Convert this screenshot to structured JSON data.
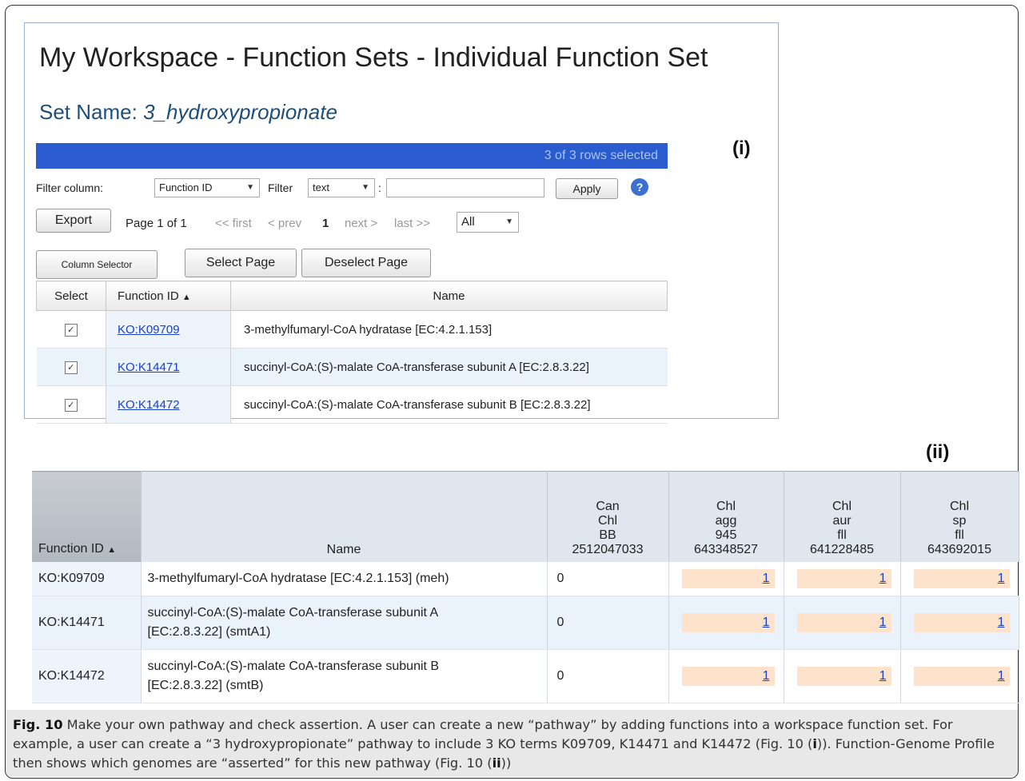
{
  "panel1": {
    "title": "My Workspace - Function Sets - Individual Function Set",
    "set_name_label": "Set Name:",
    "set_name_value": "3_hydroxypropionate",
    "label": "(i)",
    "rows_selected": "3 of 3 rows selected",
    "filter": {
      "column_label": "Filter column:",
      "column_value": "Function ID",
      "filter_label": "Filter",
      "filter_value": "text",
      "colon": ":",
      "input_value": "",
      "apply_label": "Apply",
      "help_icon": "?"
    },
    "paging": {
      "export_label": "Export",
      "page_info": "Page 1 of 1",
      "first": "<< first",
      "prev": "< prev",
      "current": "1",
      "next": "next >",
      "last": "last >>",
      "per_page": "All"
    },
    "buttons": {
      "column_selector": "Column Selector",
      "select_page": "Select Page",
      "deselect_page": "Deselect Page"
    },
    "table": {
      "headers": {
        "select": "Select",
        "function_id": "Function ID",
        "name": "Name"
      },
      "rows": [
        {
          "checked": "✓",
          "id": "KO:K09709",
          "name": "3-methylfumaryl-CoA hydratase [EC:4.2.1.153]"
        },
        {
          "checked": "✓",
          "id": "KO:K14471",
          "name": "succinyl-CoA:(S)-malate CoA-transferase subunit A [EC:2.8.3.22]"
        },
        {
          "checked": "✓",
          "id": "KO:K14472",
          "name": "succinyl-CoA:(S)-malate CoA-transferase subunit B [EC:2.8.3.22]"
        }
      ]
    }
  },
  "panel2": {
    "label": "(ii)",
    "headers": {
      "function_id": "Function ID",
      "sort_icon": "▲",
      "name": "Name",
      "genomes": [
        {
          "l1": "Can",
          "l2": "Chl",
          "l3": "BB",
          "l4": "2512047033"
        },
        {
          "l1": "Chl",
          "l2": "agg",
          "l3": "945",
          "l4": "643348527"
        },
        {
          "l1": "Chl",
          "l2": "aur",
          "l3": "fll",
          "l4": "641228485"
        },
        {
          "l1": "Chl",
          "l2": "sp",
          "l3": "fll",
          "l4": "643692015"
        }
      ]
    },
    "rows": [
      {
        "id": "KO:K09709",
        "name_l1": "3-methylfumaryl-CoA hydratase [EC:4.2.1.153] (meh)",
        "name_l2": "",
        "v": [
          "0",
          "1",
          "1",
          "1"
        ]
      },
      {
        "id": "KO:K14471",
        "name_l1": "succinyl-CoA:(S)-malate CoA-transferase subunit A",
        "name_l2": "[EC:2.8.3.22] (smtA1)",
        "v": [
          "0",
          "1",
          "1",
          "1"
        ]
      },
      {
        "id": "KO:K14472",
        "name_l1": "succinyl-CoA:(S)-malate CoA-transferase subunit B",
        "name_l2": "[EC:2.8.3.22] (smtB)",
        "v": [
          "0",
          "1",
          "1",
          "1"
        ]
      }
    ]
  },
  "caption": {
    "fig_label": "Fig. 10",
    "text_a": " Make your own pathway and check assertion. A user can create a new “pathway” by adding functions into a workspace function set. For example, a user can create a “3 hydroxypropionate” pathway to include 3 KO terms K09709, K14471 and K14472 (Fig. 10 (",
    "ref_i": "i",
    "text_b": ")). Function-Genome Profile then shows which genomes are “asserted” for this new pathway (Fig. 10 (",
    "ref_ii": "ii",
    "text_c": "))"
  }
}
